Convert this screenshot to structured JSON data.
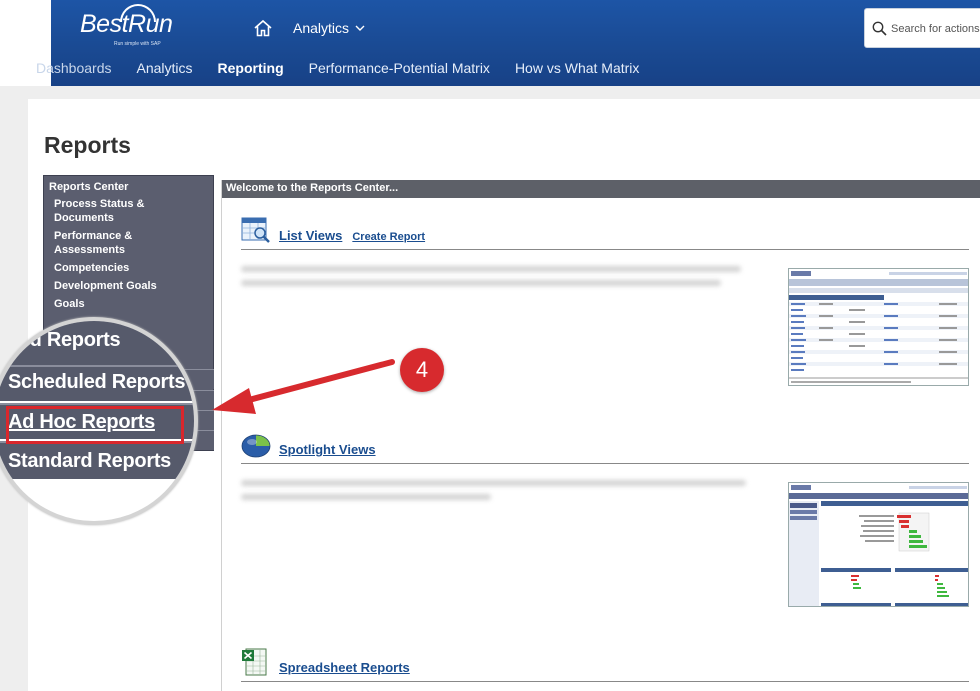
{
  "header": {
    "logo_text": "BestRun",
    "logo_tagline": "Run simple with SAP",
    "app_menu_label": "Analytics",
    "search_placeholder": "Search for actions"
  },
  "nav": {
    "tabs": [
      {
        "label": "Dashboards"
      },
      {
        "label": "Analytics"
      },
      {
        "label": "Reporting"
      },
      {
        "label": "Performance-Potential Matrix"
      },
      {
        "label": "How vs What Matrix"
      }
    ],
    "active_tab": "Reporting"
  },
  "page": {
    "title": "Reports"
  },
  "sidebar": {
    "header": "Reports Center",
    "links": [
      {
        "label": "Process Status & Documents"
      },
      {
        "label": "Performance & Assessments"
      },
      {
        "label": "Competencies"
      },
      {
        "label": "Development Goals"
      },
      {
        "label": "Goals"
      }
    ]
  },
  "magnifier": {
    "items": [
      {
        "label": "ved Reports"
      },
      {
        "label": "Scheduled Reports"
      },
      {
        "label": "Ad Hoc Reports"
      },
      {
        "label": "Standard Reports"
      }
    ],
    "highlighted": "Ad Hoc Reports"
  },
  "callout": {
    "step": "4"
  },
  "main": {
    "welcome": "Welcome to the Reports Center...",
    "sections": [
      {
        "title": "List Views",
        "link": "Create Report"
      },
      {
        "title": "Spotlight Views"
      },
      {
        "title": "Spreadsheet Reports"
      }
    ]
  },
  "colors": {
    "header_blue": "#1a4a93",
    "sidebar_bg": "#5b5e6f",
    "link_blue": "#1a4d8f",
    "callout_red": "#d72a2e"
  }
}
